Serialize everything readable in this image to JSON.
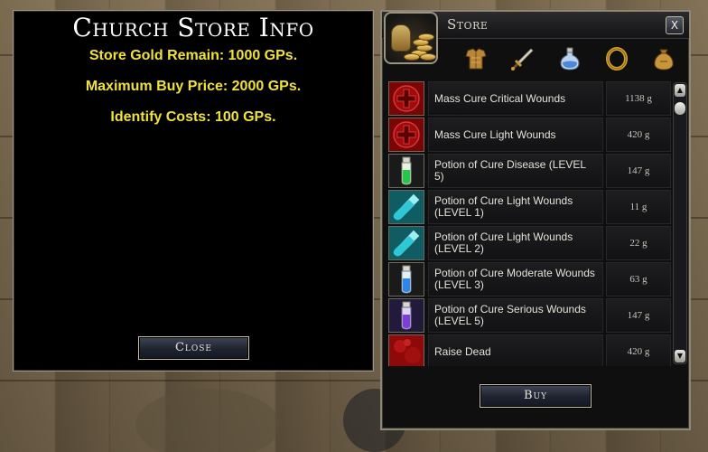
{
  "info_panel": {
    "title": "Church Store Info",
    "store_gold": "Store Gold Remain: 1000 GPs.",
    "max_buy_price": "Maximum Buy Price: 2000 GPs.",
    "identify_costs": "Identify Costs: 100 GPs.",
    "close_label": "Close"
  },
  "store": {
    "title": "Store",
    "close_glyph": "X",
    "buy_label": "Buy",
    "filters": [
      {
        "icon": "armor-icon"
      },
      {
        "icon": "sword-icon"
      },
      {
        "icon": "potion-icon"
      },
      {
        "icon": "ring-icon"
      },
      {
        "icon": "bag-icon"
      }
    ],
    "items": [
      {
        "name": "Mass Cure Critical Wounds",
        "price": "1138 g",
        "icon": "red-cross-spell-icon"
      },
      {
        "name": "Mass Cure Light Wounds",
        "price": "420 g",
        "icon": "red-cross-spell-icon"
      },
      {
        "name": "Potion of Cure Disease (LEVEL 5)",
        "price": "147 g",
        "icon": "green-potion-icon"
      },
      {
        "name": "Potion of Cure Light Wounds (LEVEL 1)",
        "price": "11 g",
        "icon": "cyan-vial-icon"
      },
      {
        "name": "Potion of Cure Light Wounds (LEVEL 2)",
        "price": "22 g",
        "icon": "cyan-vial-icon"
      },
      {
        "name": "Potion of Cure Moderate Wounds (LEVEL 3)",
        "price": "63 g",
        "icon": "blue-potion-icon"
      },
      {
        "name": "Potion of Cure Serious Wounds (LEVEL 5)",
        "price": "147 g",
        "icon": "purple-potion-icon"
      },
      {
        "name": "Raise Dead",
        "price": "420 g",
        "icon": "raise-dead-spell-icon"
      }
    ]
  }
}
